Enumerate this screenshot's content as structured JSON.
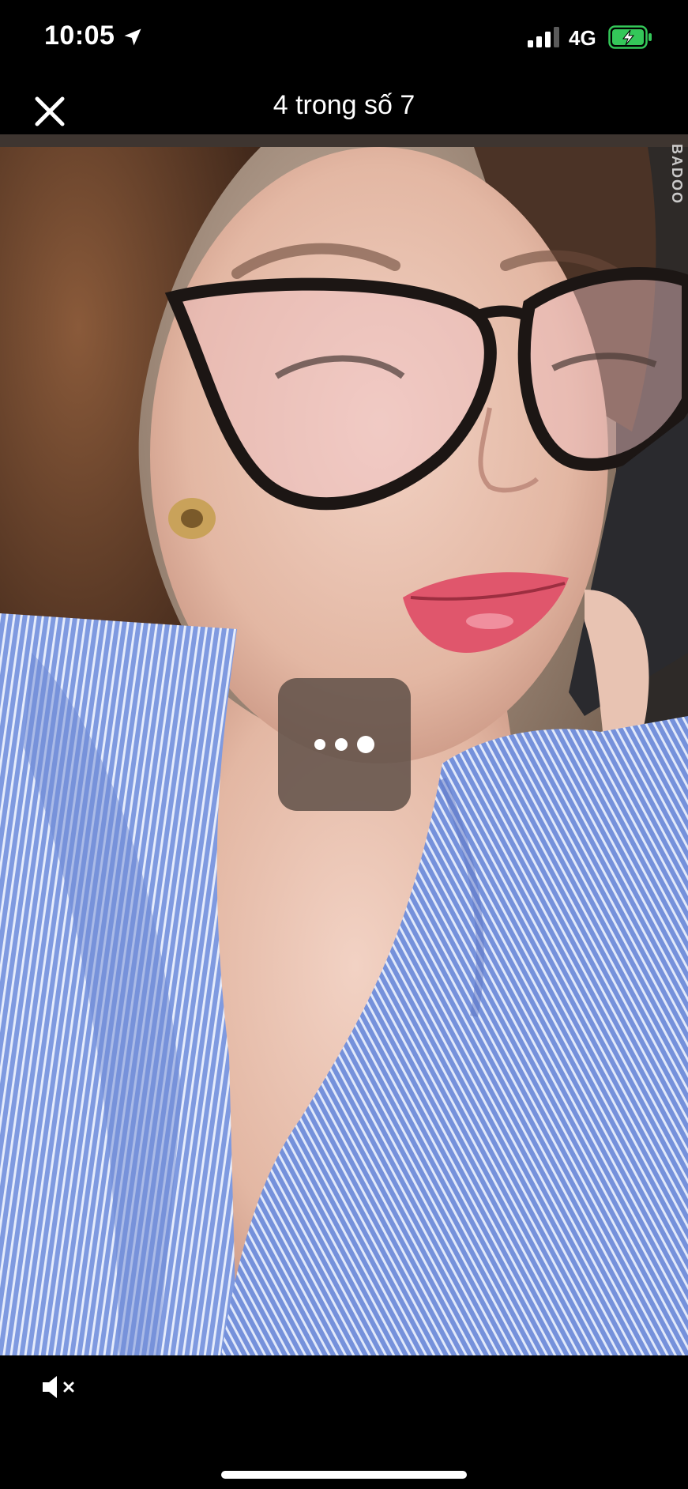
{
  "status_bar": {
    "time": "10:05",
    "network": "4G",
    "location_icon": "location-arrow-icon",
    "signal_icon": "cellular-signal-icon",
    "battery_icon": "battery-charging-icon",
    "battery_color": "#34c759"
  },
  "header": {
    "title": "4 trong số 7",
    "close_icon": "close-icon"
  },
  "media": {
    "watermark": "BADOO",
    "more_icon": "more-dots-icon"
  },
  "bottom_bar": {
    "mute_icon": "speaker-muted-icon"
  }
}
